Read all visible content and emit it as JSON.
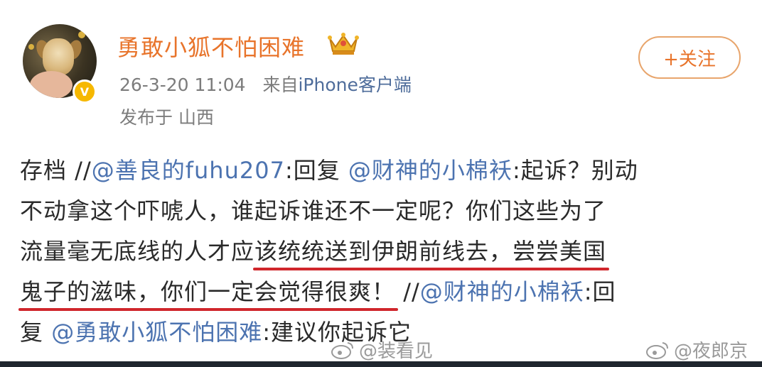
{
  "user": {
    "name": "勇敢小狐不怕困难",
    "verified": true
  },
  "meta": {
    "time": "26-3-20 11:04",
    "source_prefix": "来自",
    "source": "iPhone客户端",
    "location": "发布于 山西"
  },
  "follow_button": {
    "label": "+关注"
  },
  "post": {
    "line1": [
      {
        "t": "存档 //"
      },
      {
        "t": "@善良的fuhu207",
        "mention": true
      },
      {
        "t": ":回复 "
      },
      {
        "t": "@财神的小棉袄",
        "mention": true
      },
      {
        "t": ":起诉？别动"
      }
    ],
    "line2": [
      {
        "t": "不动拿这个吓唬人，谁起诉谁还不一定呢？你们这些为了"
      }
    ],
    "line3": [
      {
        "t": "流量毫无底线的人才应"
      },
      {
        "t": "该统统送到伊朗前线去，尝尝美国",
        "underline": true
      }
    ],
    "line4": [
      {
        "t": "鬼子的滋味，你们一定会觉得很爽！",
        "underline": true
      },
      {
        "t": " //"
      },
      {
        "t": "@财神的小棉袄",
        "mention": true
      },
      {
        "t": ":回"
      }
    ],
    "line5": [
      {
        "t": "复 "
      },
      {
        "t": "@勇敢小狐不怕困难",
        "mention": true
      },
      {
        "t": ":建议你起诉它"
      }
    ]
  },
  "watermarks": [
    "@装看见",
    "@夜郎京"
  ],
  "colors": {
    "username": "#e8742b",
    "mention": "#4c73b0",
    "underline": "#d0262c",
    "follow_border": "#e8a56c"
  }
}
